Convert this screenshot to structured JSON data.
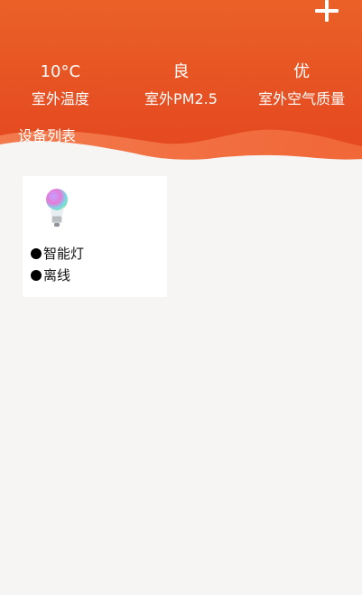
{
  "header": {
    "add_icon": "plus-icon",
    "stats": [
      {
        "value": "10°C",
        "label": "室外温度"
      },
      {
        "value": "良",
        "label": "室外PM2.5"
      },
      {
        "value": "优",
        "label": "室外空气质量"
      }
    ],
    "section_title": "设备列表",
    "colors": {
      "gradient_top": "#ef6a2c",
      "gradient_bottom": "#e6461e",
      "wave_light": "#f57a4c",
      "background": "#f6f5f4"
    }
  },
  "devices": [
    {
      "name": "智能灯",
      "status": "离线",
      "icon": "smart-bulb-icon"
    }
  ]
}
